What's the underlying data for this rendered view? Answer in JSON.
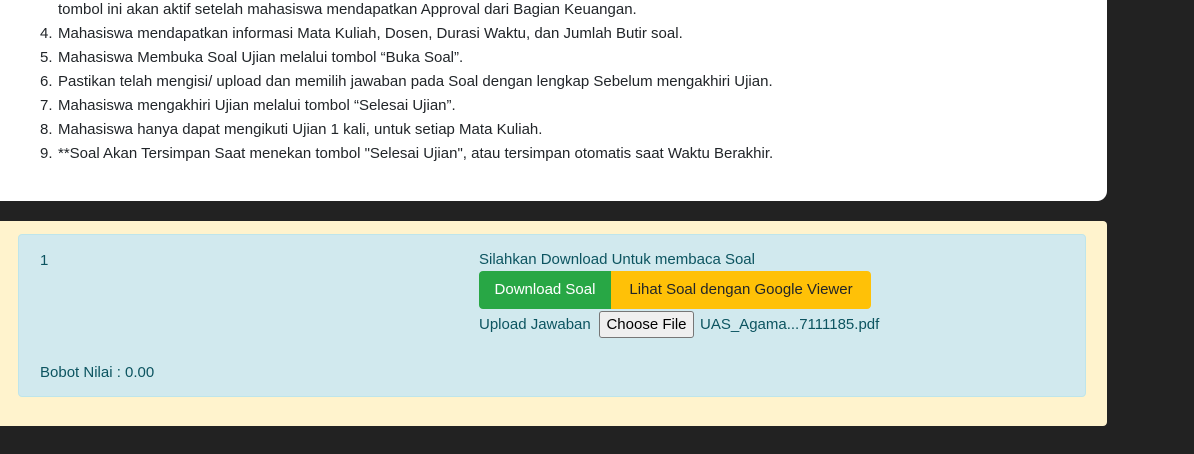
{
  "instructions": {
    "continuation_text": "tombol ini akan aktif setelah mahasiswa mendapatkan Approval dari Bagian Keuangan.",
    "items": [
      {
        "number": "4.",
        "text": "Mahasiswa mendapatkan informasi Mata Kuliah, Dosen, Durasi Waktu, dan Jumlah Butir soal."
      },
      {
        "number": "5.",
        "text": "Mahasiswa Membuka Soal Ujian melalui tombol “Buka Soal”."
      },
      {
        "number": "6.",
        "text": "Pastikan telah mengisi/ upload dan memilih jawaban pada Soal dengan lengkap Sebelum mengakhiri Ujian."
      },
      {
        "number": "7.",
        "text": "Mahasiswa mengakhiri Ujian melalui tombol “Selesai Ujian”."
      },
      {
        "number": "8.",
        "text": "Mahasiswa hanya dapat mengikuti Ujian 1 kali, untuk setiap Mata Kuliah."
      },
      {
        "number": "9.",
        "text": "**Soal Akan Tersimpan Saat menekan tombol \"Selesai Ujian\", atau tersimpan otomatis saat Waktu Berakhir."
      }
    ]
  },
  "question": {
    "number": "1",
    "weight_label": "Bobot Nilai : 0.00",
    "download_hint": "Silahkan Download Untuk membaca Soal",
    "download_button": "Download Soal",
    "viewer_button": "Lihat Soal dengan Google Viewer",
    "upload_label": "Upload Jawaban",
    "choose_file_button": "Choose File",
    "selected_file": "UAS_Agama...7111185.pdf"
  },
  "colors": {
    "background": "#222222",
    "card": "#ffffff",
    "panel": "#fff3cd",
    "item_bg": "#d1e9ee",
    "item_text": "#0c5460",
    "download_button": "#28a745",
    "viewer_button": "#ffc107"
  }
}
